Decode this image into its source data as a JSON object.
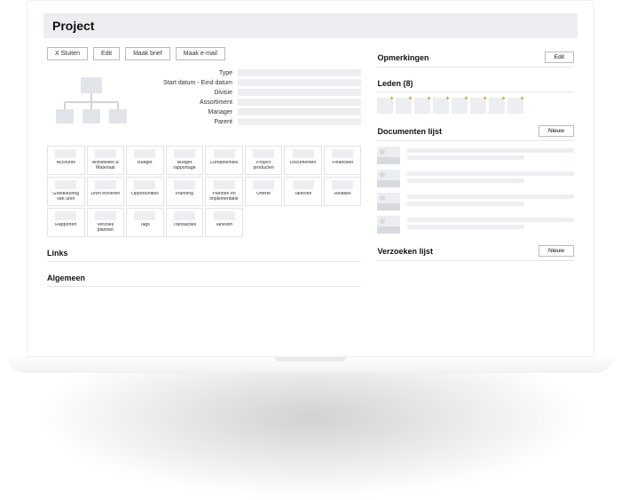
{
  "page": {
    "title": "Project"
  },
  "toolbar": {
    "close": "X Sluiten",
    "edit": "Edit",
    "brief": "Maak brief",
    "email": "Maak e-mail"
  },
  "fields": {
    "type": "Type",
    "dates": "Start datum - Eind datum",
    "division": "Divisie",
    "assortment": "Assortiment",
    "manager": "Manager",
    "parent": "Parent"
  },
  "tabs": [
    "Accounts",
    "Activiteiten & Materiaal",
    "Budget",
    "Budget rapportage",
    "Competenties",
    "Project producten",
    "Documenten",
    "Financieel",
    "Goedkeuring van uren",
    "Uren invoeren",
    "Opportunities",
    "Planning",
    "Plannen en implementatie",
    "Offerte",
    "Tarieven",
    "Relaties",
    "Rapporten",
    "Verzoek plannen",
    "Tags",
    "Transacties",
    "Tarieven"
  ],
  "sections": {
    "links": "Links",
    "general": "Algemeen",
    "notes": "Opmerkingen",
    "members": "Leden (8)",
    "documents": "Documenten lijst",
    "requests": "Verzoeken lijst"
  },
  "buttons": {
    "edit": "Edit",
    "new": "Nieuw"
  },
  "members_count": 8,
  "documents_rows": 4
}
